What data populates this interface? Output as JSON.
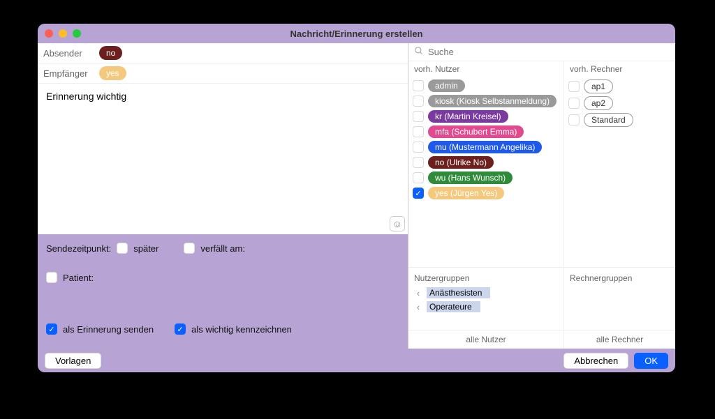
{
  "window": {
    "title": "Nachricht/Erinnerung erstellen"
  },
  "header": {
    "sender_label": "Absender",
    "sender_value": "no",
    "sender_color": "#6d1f1d",
    "recipient_label": "Empfänger",
    "recipient_value": "yes",
    "recipient_color": "#f4c97e"
  },
  "message": {
    "text": "Erinnerung wichtig"
  },
  "options": {
    "send_time_label": "Sendezeitpunkt:",
    "later_label": "später",
    "later_checked": false,
    "expires_label": "verfällt am:",
    "expires_checked": false,
    "patient_label": "Patient:",
    "patient_checked": false,
    "reminder_label": "als Erinnerung senden",
    "reminder_checked": true,
    "important_label": "als wichtig kennzeichnen",
    "important_checked": true
  },
  "search": {
    "placeholder": "Suche"
  },
  "right": {
    "users_header": "vorh. Nutzer",
    "machines_header": "vorh. Rechner",
    "users": [
      {
        "label": "admin",
        "checked": false,
        "bg": "#9a9a9a",
        "fg": "#fff"
      },
      {
        "label": "kiosk (Kiosk Selbstanmeldung)",
        "checked": false,
        "bg": "#9a9a9a",
        "fg": "#fff"
      },
      {
        "label": "kr (Martin Kreisel)",
        "checked": false,
        "bg": "#7b3aa0",
        "fg": "#fff"
      },
      {
        "label": "mfa (Schubert Emma)",
        "checked": false,
        "bg": "#e24a8f",
        "fg": "#fff"
      },
      {
        "label": "mu (Mustermann Angelika)",
        "checked": false,
        "bg": "#1f59ea",
        "fg": "#fff"
      },
      {
        "label": "no (Ulrike No)",
        "checked": false,
        "bg": "#6d1f1d",
        "fg": "#fff"
      },
      {
        "label": "wu (Hans Wunsch)",
        "checked": false,
        "bg": "#2f8a3a",
        "fg": "#fff"
      },
      {
        "label": "yes (Jürgen Yes)",
        "checked": true,
        "bg": "#f4c97e",
        "fg": "#fff"
      }
    ],
    "machines": [
      {
        "label": "ap1",
        "checked": false
      },
      {
        "label": "ap2",
        "checked": false
      },
      {
        "label": "Standard",
        "checked": false
      }
    ],
    "user_groups_header": "Nutzergruppen",
    "machine_groups_header": "Rechnergruppen",
    "user_groups": [
      {
        "label": "Anästhesisten"
      },
      {
        "label": "Operateure"
      }
    ],
    "all_users_label": "alle Nutzer",
    "all_machines_label": "alle Rechner"
  },
  "footer": {
    "templates_label": "Vorlagen",
    "cancel_label": "Abbrechen",
    "ok_label": "OK"
  }
}
